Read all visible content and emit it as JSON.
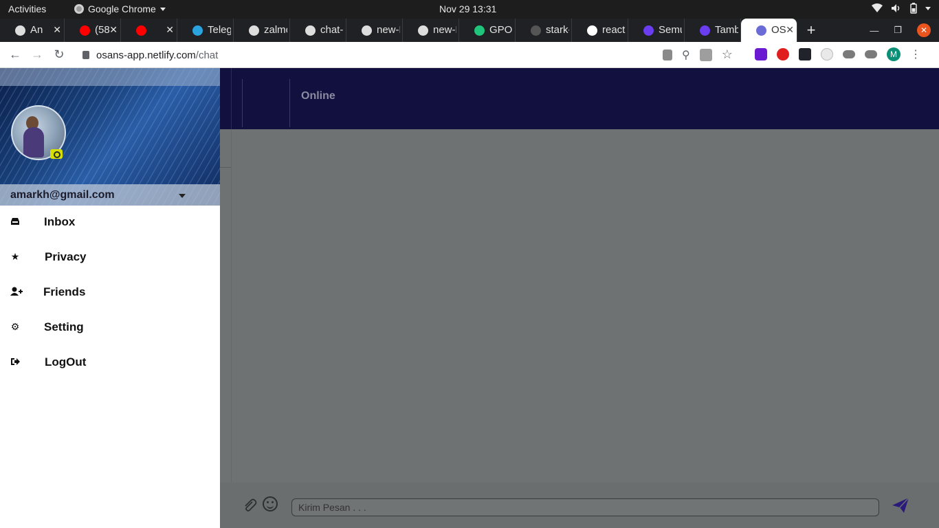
{
  "os_bar": {
    "activities": "Activities",
    "app_name": "Google Chrome",
    "clock": "Nov 29  13:31"
  },
  "browser": {
    "tabs": [
      {
        "title": "An",
        "icon": "github-icon",
        "color": "#dddddd"
      },
      {
        "title": "(58",
        "icon": "youtube-icon",
        "color": "#ff0000"
      },
      {
        "title": "",
        "icon": "youtube-icon",
        "color": "#ff0000"
      },
      {
        "title": "Teleg",
        "icon": "telegram-icon",
        "color": "#2aa3df"
      },
      {
        "title": "zalmo",
        "icon": "github-icon",
        "color": "#dddddd"
      },
      {
        "title": "chat-a",
        "icon": "github-icon",
        "color": "#dddddd"
      },
      {
        "title": "new-P",
        "icon": "github-icon",
        "color": "#dddddd"
      },
      {
        "title": "new-P",
        "icon": "github-icon",
        "color": "#dddddd"
      },
      {
        "title": "GPOS",
        "icon": "gpos-icon",
        "color": "#1ec57a"
      },
      {
        "title": "stark-",
        "icon": "globe-icon",
        "color": "#555555"
      },
      {
        "title": "react",
        "icon": "google-icon",
        "color": "#ffffff"
      },
      {
        "title": "Semu",
        "icon": "c-icon",
        "color": "#6a3df0"
      },
      {
        "title": "Tamb",
        "icon": "c-icon",
        "color": "#6a3df0"
      },
      {
        "title": "OS",
        "icon": "osans-icon",
        "color": "#6b6bd6",
        "active": true
      }
    ],
    "url_domain": "osans-app.netlify.com",
    "url_path": "/chat",
    "profile_initial": "M"
  },
  "app": {
    "user_email": "amarkh@gmail.com",
    "menu": [
      {
        "label": "Inbox",
        "icon": "inbox-icon"
      },
      {
        "label": "Privacy",
        "icon": "star-icon"
      },
      {
        "label": "Friends",
        "icon": "add-friend-icon"
      },
      {
        "label": "Setting",
        "icon": "gear-icon"
      },
      {
        "label": "LogOut",
        "icon": "logout-icon"
      }
    ],
    "chat_status": "Online",
    "message_placeholder": "Kirim Pesan . . .",
    "colors": {
      "header_bg": "#11103f",
      "send_icon": "#2a1a7a",
      "camera_icon": "#d6e000"
    }
  }
}
